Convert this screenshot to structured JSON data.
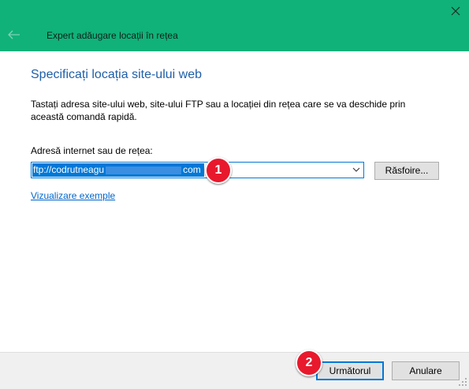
{
  "window": {
    "title": "Expert adăugare locații în rețea",
    "title_bg": "#10b27a"
  },
  "page": {
    "heading": "Specificați locația site-ului web",
    "description": "Tastați adresa site-ului web, site-ului FTP sau a locației din rețea care se va deschide prin această comandă rapidă."
  },
  "address": {
    "label": "Adresă internet sau de rețea:",
    "value_start": "ftp://codrutneagu",
    "value_end": "com"
  },
  "buttons": {
    "browse": "Răsfoire...",
    "next": "Următorul",
    "cancel": "Anulare"
  },
  "links": {
    "examples": "Vizualizare exemple"
  },
  "annotations": {
    "step1": "1",
    "step2": "2",
    "color": "#e8192c"
  },
  "icons": [
    "close-icon",
    "back-arrow-icon",
    "chevron-down-icon",
    "resize-grip-icon"
  ]
}
